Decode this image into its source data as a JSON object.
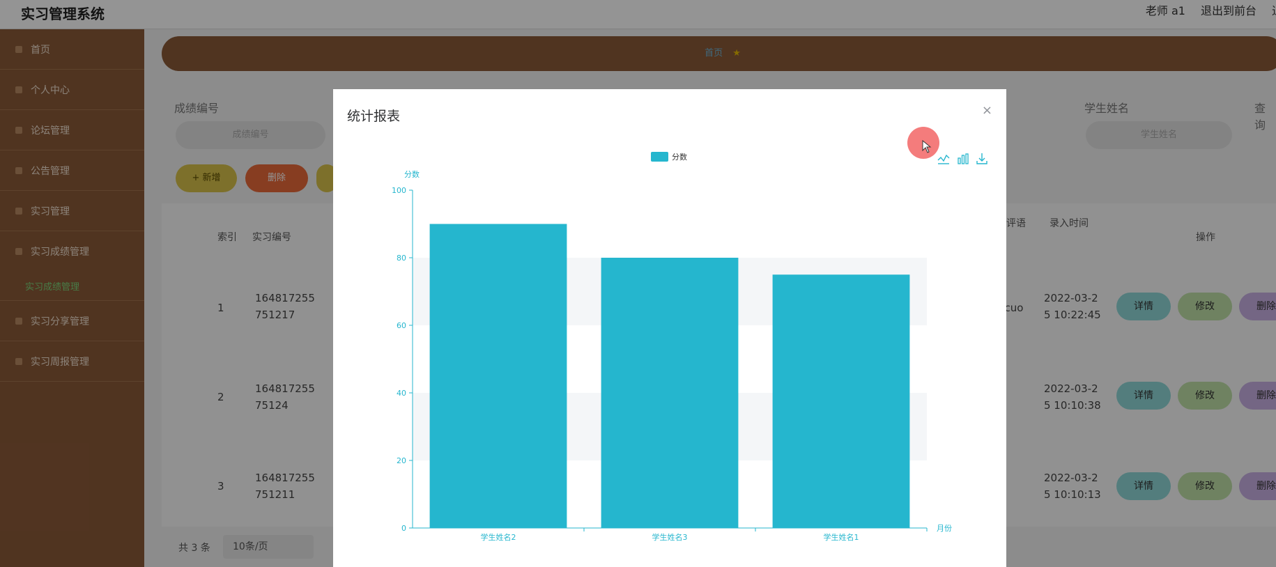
{
  "app": {
    "title": "实习管理系统"
  },
  "header": {
    "user": "老师 a1",
    "back_front": "退出到前台",
    "logout": "退"
  },
  "sidebar": {
    "items": [
      {
        "label": "首页"
      },
      {
        "label": "个人中心"
      },
      {
        "label": "论坛管理"
      },
      {
        "label": "公告管理"
      },
      {
        "label": "实习管理"
      },
      {
        "label": "实习成绩管理"
      },
      {
        "label": "实习成绩管理",
        "sub": true
      },
      {
        "label": "实习分享管理"
      },
      {
        "label": "实习周报管理"
      }
    ]
  },
  "breadcrumb": {
    "home": "首页"
  },
  "filters": {
    "score_no_label": "成绩编号",
    "score_no_placeholder": "成绩编号",
    "student_name_label": "学生姓名",
    "student_name_placeholder": "学生姓名",
    "query_label": "查询"
  },
  "toolbar": {
    "add": "+ 新增",
    "delete": "删除"
  },
  "table": {
    "headers": {
      "index": "索引",
      "intern_no": "实习编号",
      "comment": "评语",
      "entry_time": "录入时间",
      "ops": "操作"
    },
    "rows": [
      {
        "index": "1",
        "intern_no": "164817255 751217",
        "comment": "ucuo",
        "time": "2022-03-2 5 10:22:45"
      },
      {
        "index": "2",
        "intern_no": "164817255 75124",
        "comment": "",
        "time": "2022-03-2 5 10:10:38"
      },
      {
        "index": "3",
        "intern_no": "164817255 751211",
        "comment": "",
        "time": "2022-03-2 5 10:10:13"
      }
    ],
    "ops": {
      "detail": "详情",
      "edit": "修改",
      "delete": "删除"
    }
  },
  "pager": {
    "total": "共 3 条",
    "page_size": "10条/页"
  },
  "modal": {
    "title": "统计报表",
    "close": "×"
  },
  "chart_data": {
    "type": "bar",
    "legend": [
      "分数"
    ],
    "ylabel": "分数",
    "xlabel": "月份",
    "categories": [
      "学生姓名2",
      "学生姓名3",
      "学生姓名1"
    ],
    "series": [
      {
        "name": "分数",
        "values": [
          90,
          80,
          75
        ]
      }
    ],
    "ylim": [
      0,
      100
    ],
    "yticks": [
      0,
      20,
      40,
      60,
      80,
      100
    ],
    "color": "#25b6ce",
    "toolbox": [
      "line-chart-icon",
      "bar-chart-icon",
      "download-icon"
    ]
  },
  "colors": {
    "sidebar": "#8b5a38",
    "accent": "#25b6ce"
  }
}
